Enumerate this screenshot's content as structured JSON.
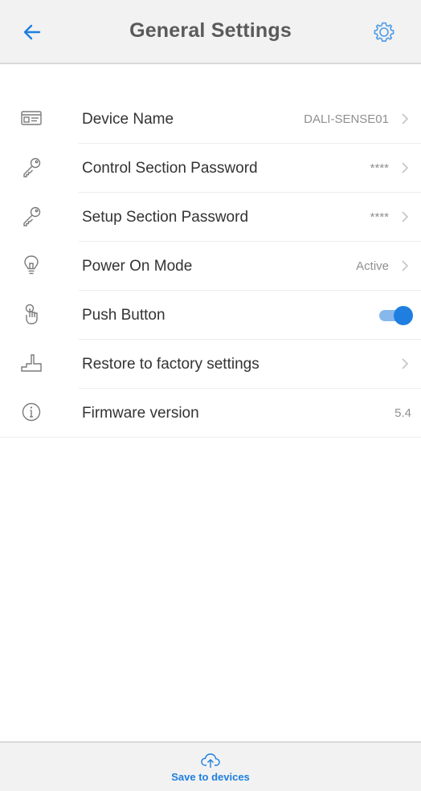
{
  "header": {
    "title": "General Settings",
    "back_icon": "arrow-left-icon",
    "settings_icon": "gear-icon"
  },
  "settings": [
    {
      "id": "device-name",
      "icon": "id-card-icon",
      "label": "Device Name",
      "value": "DALI-SENSE01",
      "control": "chevron"
    },
    {
      "id": "control-password",
      "icon": "key-icon",
      "label": "Control Section Password",
      "value": "****",
      "control": "chevron"
    },
    {
      "id": "setup-password",
      "icon": "key-icon",
      "label": "Setup Section Password",
      "value": "****",
      "control": "chevron"
    },
    {
      "id": "power-on-mode",
      "icon": "lightbulb-icon",
      "label": "Power On Mode",
      "value": "Active",
      "control": "chevron"
    },
    {
      "id": "push-button",
      "icon": "hand-press-icon",
      "label": "Push Button",
      "value": "",
      "control": "toggle",
      "toggle_on": true
    },
    {
      "id": "factory-restore",
      "icon": "factory-reset-icon",
      "label": "Restore to factory settings",
      "value": "",
      "control": "chevron"
    },
    {
      "id": "firmware-version",
      "icon": "info-icon",
      "label": "Firmware version",
      "value": "5.4",
      "control": "none"
    }
  ],
  "footer": {
    "save_label": "Save to devices",
    "icon": "cloud-upload-icon"
  },
  "colors": {
    "accent": "#1f7fe0",
    "toggle_track": "#86b8ec",
    "header_bg": "#f2f2f2",
    "title_text": "#5a5a5a",
    "label_text": "#333333",
    "value_text": "#8f8f8f"
  }
}
